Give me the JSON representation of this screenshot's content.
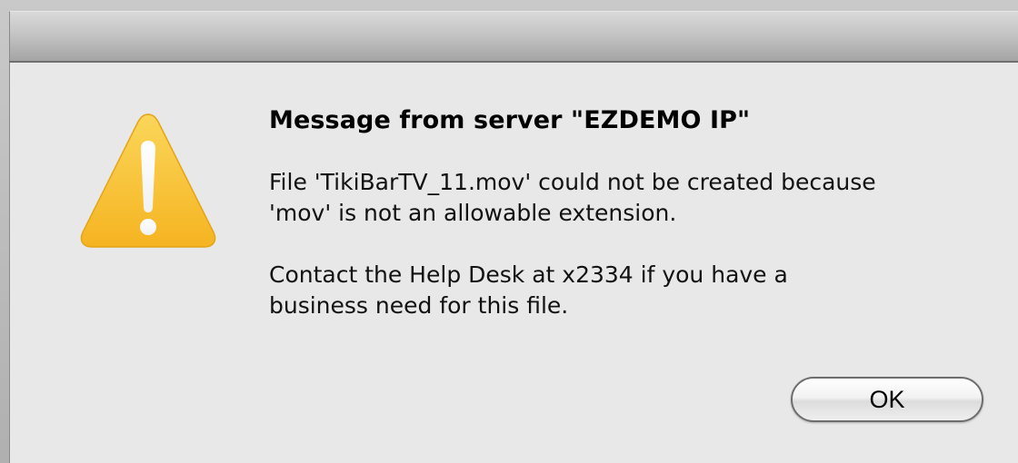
{
  "dialog": {
    "icon": "warning-triangle-icon",
    "title": "Message from server \"EZDEMO IP\"",
    "body": {
      "line1": "File 'TikiBarTV_11.mov' could not be created because",
      "line2": "'mov' is not an allowable extension.",
      "line3": "Contact the Help Desk at x2334 if you have a",
      "line4": "business need for this file."
    },
    "ok_label": "OK"
  },
  "colors": {
    "warning_yellow": "#f8c53a",
    "dialog_background": "#e8e8e8"
  }
}
